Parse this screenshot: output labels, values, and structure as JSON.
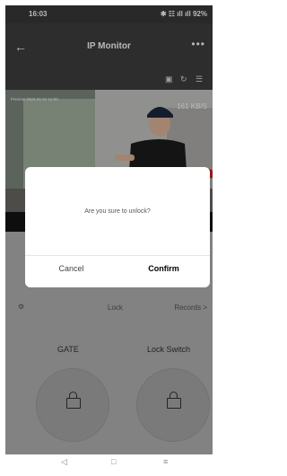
{
  "status_bar": {
    "time": "16:03",
    "right": "✱ ☷ ıll ıll 92%"
  },
  "header": {
    "title": "IP Monitor",
    "back_icon": "←",
    "more_icon": "•••"
  },
  "toolbar": {
    "snapshot_icon": "▣",
    "record_icon": "↻",
    "menu_icon": "☰"
  },
  "video": {
    "timestamp": "Preview 2023-01-01 12:00",
    "bitrate": "161 KB/S"
  },
  "controls": {
    "lock_label": "Lock",
    "records_label": "Records >",
    "gate_label": "GATE",
    "lock_switch_label": "Lock Switch"
  },
  "dialog": {
    "message": "Are you sure to unlock?",
    "cancel": "Cancel",
    "confirm": "Confirm"
  },
  "nav": {
    "back": "◁",
    "home": "□",
    "menu": "≡"
  }
}
